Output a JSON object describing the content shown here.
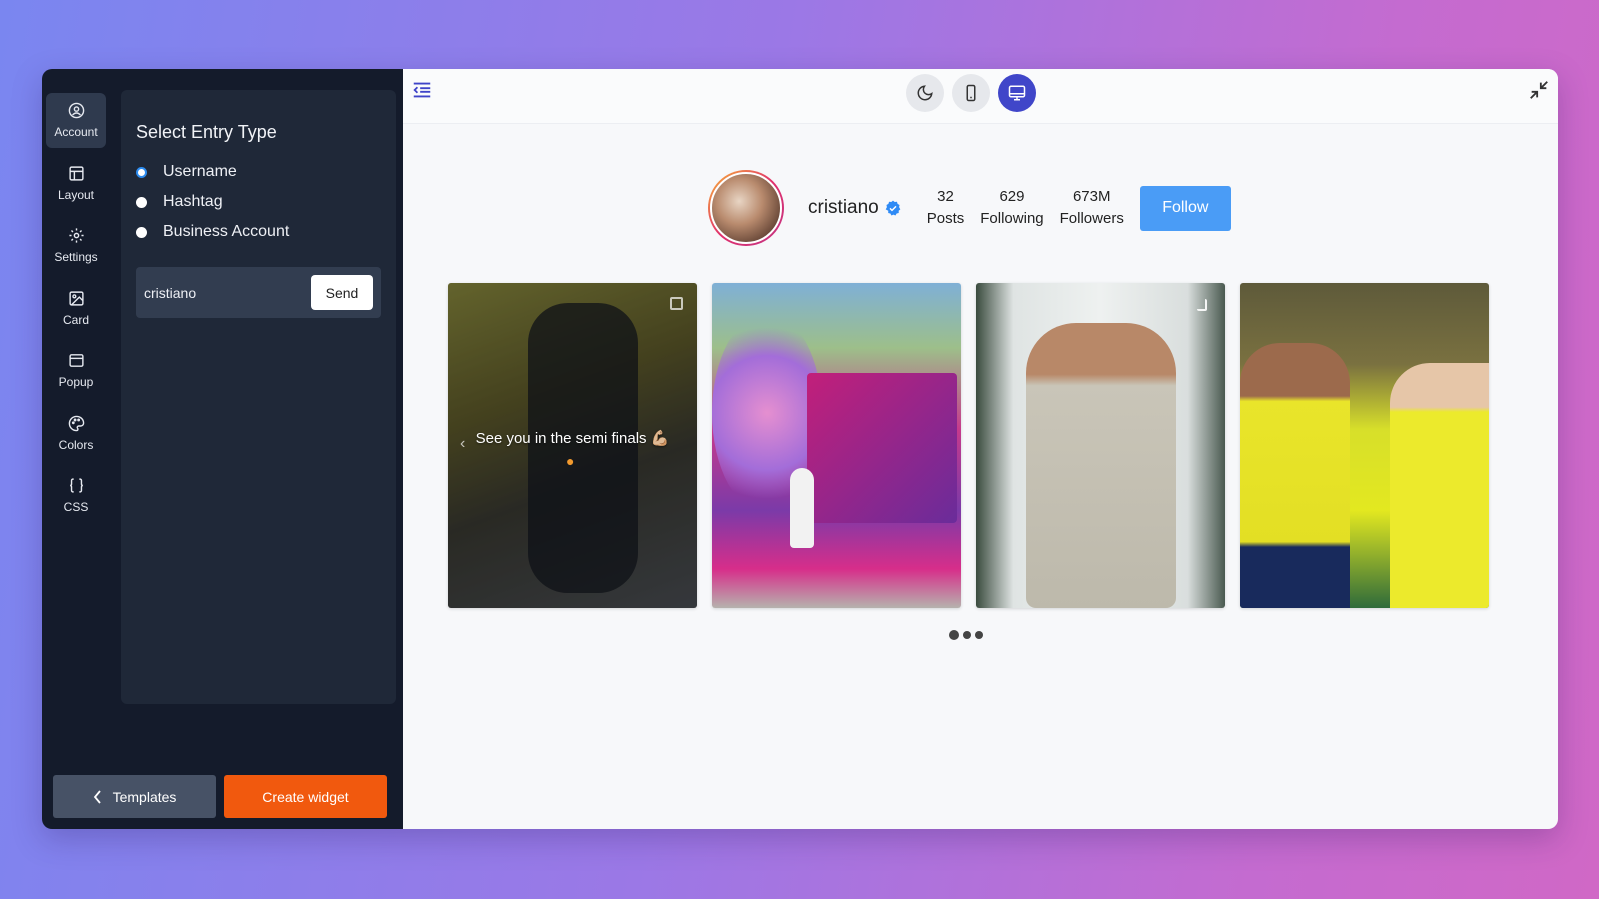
{
  "sidebar": {
    "items": [
      {
        "label": "Account",
        "icon": "account-icon",
        "active": true
      },
      {
        "label": "Layout",
        "icon": "layout-icon"
      },
      {
        "label": "Settings",
        "icon": "gear-icon"
      },
      {
        "label": "Card",
        "icon": "image-icon"
      },
      {
        "label": "Popup",
        "icon": "popup-icon"
      },
      {
        "label": "Colors",
        "icon": "palette-icon"
      },
      {
        "label": "CSS",
        "icon": "braces-icon"
      }
    ]
  },
  "panel": {
    "title": "Select Entry Type",
    "options": [
      {
        "label": "Username",
        "checked": true
      },
      {
        "label": "Hashtag",
        "checked": false
      },
      {
        "label": "Business Account",
        "checked": false
      }
    ],
    "input_value": "cristiano",
    "send_label": "Send"
  },
  "footer": {
    "templates_label": "Templates",
    "create_label": "Create widget"
  },
  "profile": {
    "username": "cristiano",
    "posts_count": "32",
    "posts_label": "Posts",
    "following_count": "629",
    "following_label": "Following",
    "followers_count": "673M",
    "followers_label": "Followers",
    "follow_label": "Follow"
  },
  "posts": [
    {
      "caption": "See you in the semi finals 💪🏼"
    }
  ],
  "colors": {
    "accent": "#4046c9",
    "follow": "#4a9cf6",
    "create": "#f1590e"
  }
}
